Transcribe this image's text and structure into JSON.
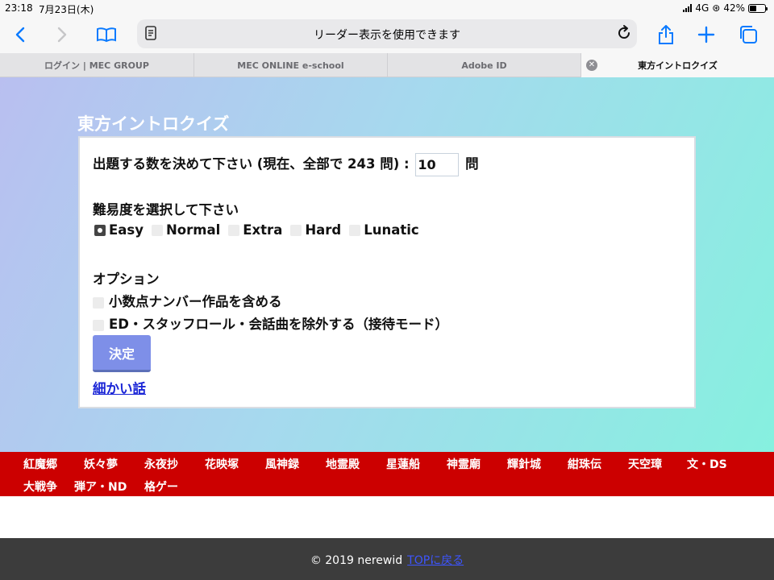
{
  "status_bar": {
    "time": "23:18",
    "date": "7月23日(木)",
    "network": "4G",
    "battery": "42%",
    "battery_level": 0.42
  },
  "browser": {
    "address_text": "リーダー表示を使用できます",
    "tabs": [
      {
        "label": "ログイン | MEC GROUP",
        "active": false
      },
      {
        "label": "MEC ONLINE e-school",
        "active": false
      },
      {
        "label": "Adobe ID",
        "active": false
      },
      {
        "label": "東方イントロクイズ",
        "active": true
      }
    ]
  },
  "page": {
    "title": "東方イントロクイズ",
    "count_prompt": "出題する数を決めて下さい (現在、全部で 243 問) :",
    "count_value": "10",
    "count_unit": "問",
    "difficulty_heading": "難易度を選択して下さい",
    "difficulties": [
      {
        "label": "Easy",
        "checked": true
      },
      {
        "label": "Normal",
        "checked": false
      },
      {
        "label": "Extra",
        "checked": false
      },
      {
        "label": "Hard",
        "checked": false
      },
      {
        "label": "Lunatic",
        "checked": false
      }
    ],
    "options_heading": "オプション",
    "options": [
      {
        "label": "小数点ナンバー作品を含める",
        "checked": false
      },
      {
        "label": "ED・スタッフロール・会話曲を除外する（接待モード）",
        "checked": false
      }
    ],
    "submit_label": "決定",
    "detail_link": "細かい話"
  },
  "nav": {
    "items": [
      "紅魔郷",
      "妖々夢",
      "永夜抄",
      "花映塚",
      "風神録",
      "地霊殿",
      "星蓮船",
      "神霊廟",
      "輝針城",
      "紺珠伝",
      "天空璋",
      "文・DS",
      "大戦争",
      "弾ア・ND",
      "格ゲー"
    ]
  },
  "footer": {
    "copyright": "© 2019 nerewid",
    "top_link": "TOPに戻る"
  },
  "colors": {
    "nav_bg": "#cc0000",
    "button": "#7e8fe8",
    "footer_bg": "#3c3c3c",
    "link": "#1a25d6",
    "ios_blue": "#0a7aff"
  }
}
